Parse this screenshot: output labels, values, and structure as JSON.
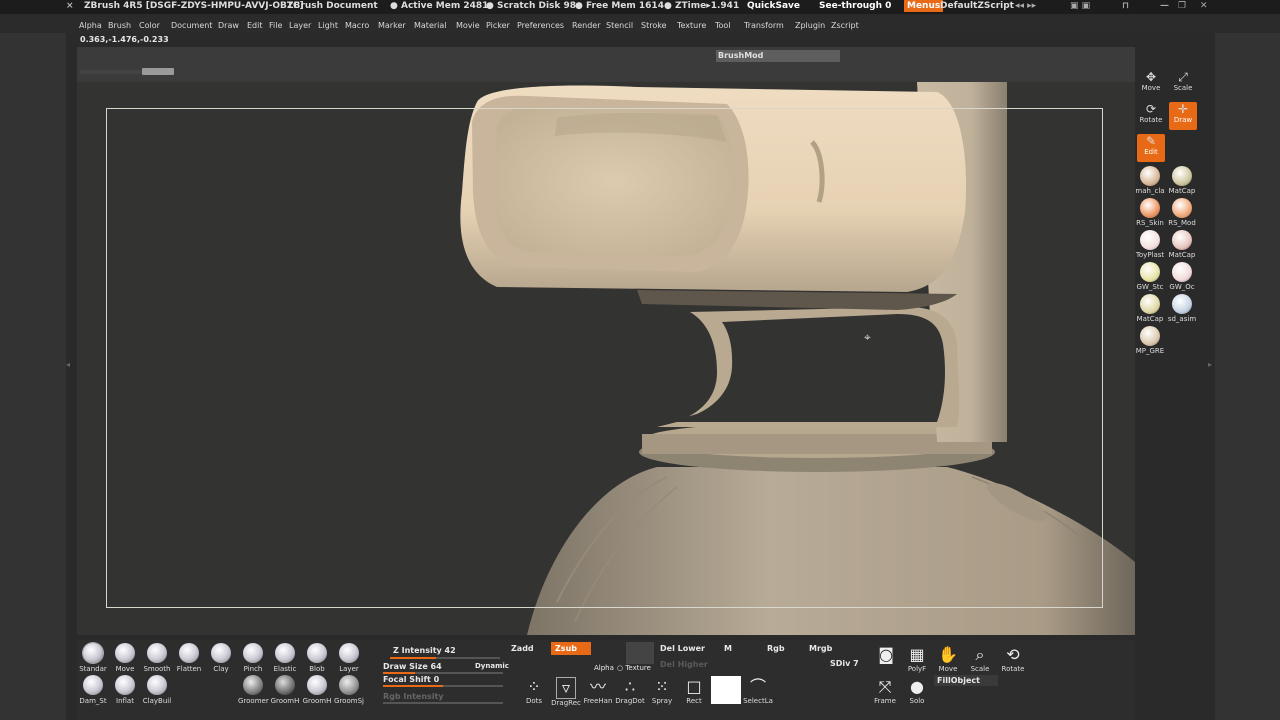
{
  "titlebar": {
    "app": "ZBrush 4R5 [DSGF-ZDYS-HMPU-AVVJ-OBTC]",
    "document": "ZBrush Document",
    "active_mem": "● Active Mem 2481",
    "scratch_disk": "● Scratch Disk 98",
    "free_mem": "● Free Mem 1614",
    "ztime": "● ZTime▸1.941",
    "quicksave": "QuickSave",
    "see_through": "See-through  0",
    "menus": "Menus",
    "default_zscript": "DefaultZScript"
  },
  "menubar": [
    "Alpha",
    "Brush",
    "Color",
    "Document",
    "Draw",
    "Edit",
    "File",
    "Layer",
    "Light",
    "Macro",
    "Marker",
    "Material",
    "Movie",
    "Picker",
    "Preferences",
    "Render",
    "Stencil",
    "Stroke",
    "Texture",
    "Tool",
    "Transform",
    "Zplugin",
    "Zscript"
  ],
  "coords": "0.363,-1.476,-0.233",
  "brushmod": "BrushMod",
  "right_shelf": {
    "move": "Move",
    "scale": "Scale",
    "rotate": "Rotate",
    "draw": "Draw",
    "edit": "Edit",
    "materials": [
      "mah_cla",
      "MatCap",
      "RS_Skin",
      "RS_Mod",
      "ToyPlast",
      "MatCap",
      "GW_Stc",
      "GW_Oc",
      "MatCap",
      "sd_asim",
      "MP_GRE"
    ]
  },
  "brushes_row1": [
    "Standar",
    "Move",
    "Smooth",
    "Flatten",
    "Clay",
    "Pinch",
    "Elastic",
    "Blob",
    "Layer"
  ],
  "brushes_row2": [
    "Dam_St",
    "Inflat",
    "ClayBuil"
  ],
  "brushes_row2b": [
    "Groomer",
    "GroomH",
    "GroomH",
    "GroomSj"
  ],
  "draw_controls": {
    "z_intensity": "Z Intensity 42",
    "z_intensity_value": 42,
    "draw_size": "Draw Size 64",
    "dynamic": "Dynamic",
    "focal_shift": "Focal Shift 0",
    "rgb_intensity": "Rgb Intensity",
    "zadd": "Zadd",
    "zsub": "Zsub",
    "alpha": "Alpha",
    "texture": "○ Texture",
    "del_lower": "Del Lower",
    "del_higher": "Del Higher",
    "m": "M",
    "rgb": "Rgb",
    "mrgb": "Mrgb",
    "sdiv": "SDiv 7",
    "fillobject": "FillObject"
  },
  "strokes": [
    "Dots",
    "DragRec",
    "FreeHan",
    "DragDot",
    "Spray",
    "Rect",
    "SelectLa"
  ],
  "bottom_right": {
    "polyf": "PolyF",
    "move": "Move",
    "scale": "Scale",
    "rotate": "Rotate",
    "frame": "Frame",
    "solo": "Solo"
  },
  "colors": {
    "accent": "#e86a16",
    "background": "#2a2a2a",
    "clay": "#cdbba2"
  }
}
